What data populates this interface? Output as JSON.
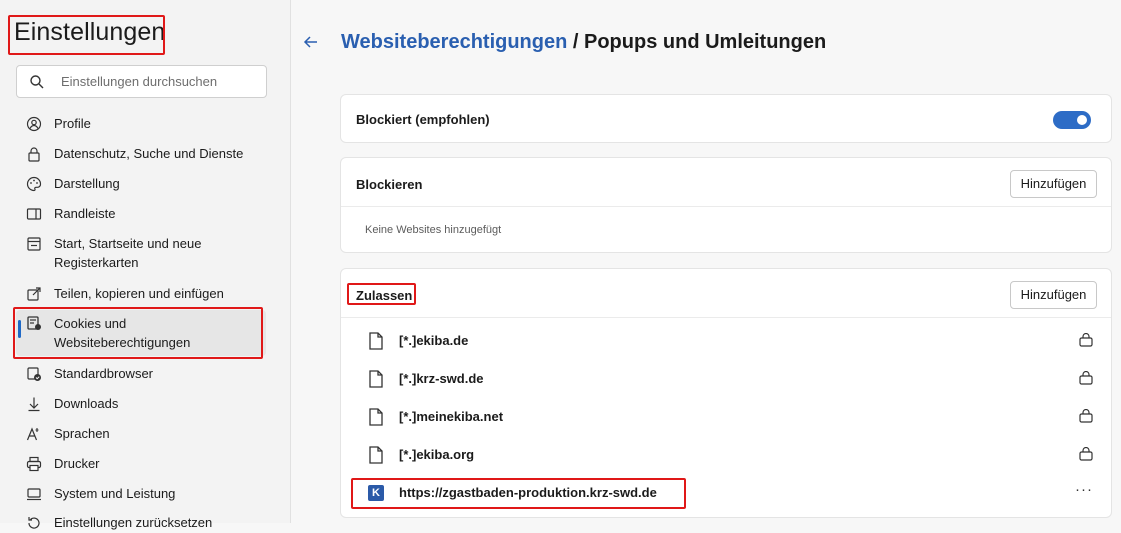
{
  "sidebar": {
    "title": "Einstellungen",
    "search_placeholder": "Einstellungen durchsuchen",
    "items": [
      {
        "label": "Profile",
        "icon": "profile-icon"
      },
      {
        "label": "Datenschutz, Suche und Dienste",
        "icon": "lock-icon"
      },
      {
        "label": "Darstellung",
        "icon": "palette-icon"
      },
      {
        "label": "Randleiste",
        "icon": "sidebar-icon"
      },
      {
        "label": "Start, Startseite und neue Registerkarten",
        "icon": "home-tab-icon"
      },
      {
        "label": "Teilen, kopieren und einfügen",
        "icon": "share-icon"
      },
      {
        "label": "Cookies und Websiteberechtigungen",
        "icon": "cookies-icon",
        "active": true
      },
      {
        "label": "Standardbrowser",
        "icon": "default-browser-icon"
      },
      {
        "label": "Downloads",
        "icon": "download-icon"
      },
      {
        "label": "Sprachen",
        "icon": "languages-icon"
      },
      {
        "label": "Drucker",
        "icon": "printer-icon"
      },
      {
        "label": "System und Leistung",
        "icon": "system-icon"
      },
      {
        "label": "Einstellungen zurücksetzen",
        "icon": "reset-icon"
      }
    ]
  },
  "header": {
    "breadcrumb": "Websiteberechtigungen",
    "separator": " / ",
    "title": "Popups und Umleitungen"
  },
  "blocked_card": {
    "label": "Blockiert (empfohlen)",
    "toggle_on": true
  },
  "block_card": {
    "title": "Blockieren",
    "add_label": "Hinzufügen",
    "empty_text": "Keine Websites hinzugefügt"
  },
  "allow_card": {
    "title": "Zulassen",
    "add_label": "Hinzufügen",
    "sites": [
      {
        "name": "[*.]ekiba.de"
      },
      {
        "name": "[*.]krz-swd.de"
      },
      {
        "name": "[*.]meinekiba.net"
      },
      {
        "name": "[*.]ekiba.org"
      },
      {
        "name": "https://zgastbaden-produktion.krz-swd.de"
      }
    ],
    "more_label": "···",
    "favicon_letter": "K"
  },
  "colors": {
    "accent": "#2d6cc6",
    "highlight": "#e01818"
  }
}
